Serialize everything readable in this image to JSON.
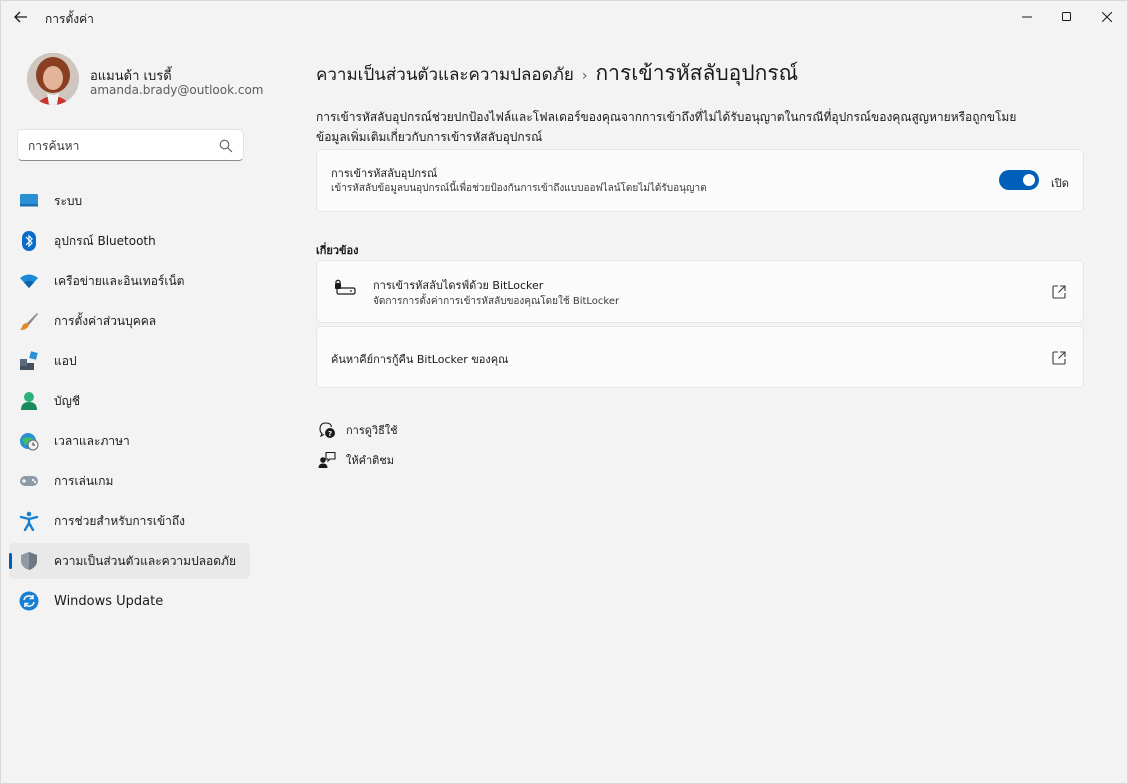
{
  "window": {
    "title": "การตั้งค่า"
  },
  "profile": {
    "name": "อแมนด้า เบรดี้",
    "email": "amanda.brady@outlook.com"
  },
  "search": {
    "placeholder": "การค้นหา"
  },
  "sidebar": {
    "items": [
      {
        "label": "ระบบ",
        "icon": "monitor-icon"
      },
      {
        "label": "อุปกรณ์ Bluetooth",
        "icon": "bluetooth-icon"
      },
      {
        "label": "เครือข่ายและอินเทอร์เน็ต",
        "icon": "wifi-icon"
      },
      {
        "label": "การตั้งค่าส่วนบุคคล",
        "icon": "brush-icon"
      },
      {
        "label": "แอป",
        "icon": "apps-icon"
      },
      {
        "label": "บัญชี",
        "icon": "account-icon"
      },
      {
        "label": "เวลาและภาษา",
        "icon": "globe-clock-icon"
      },
      {
        "label": "การเล่นเกม",
        "icon": "gamepad-icon"
      },
      {
        "label": "การช่วยสำหรับการเข้าถึง",
        "icon": "accessibility-icon"
      },
      {
        "label": "ความเป็นส่วนตัวและความปลอดภัย",
        "icon": "shield-icon",
        "active": true
      },
      {
        "label": "Windows Update",
        "icon": "update-icon"
      }
    ]
  },
  "header": {
    "parent": "ความเป็นส่วนตัวและความปลอดภัย",
    "separator": "›",
    "current": "การเข้ารหัสลับอุปกรณ์"
  },
  "main": {
    "description": "การเข้ารหัสลับอุปกรณ์ช่วยปกป้องไฟล์และโฟลเดอร์ของคุณจากการเข้าถึงที่ไม่ได้รับอนุญาตในกรณีที่อุปกรณ์ของคุณสูญหายหรือถูกขโมย",
    "learn_more": "ข้อมูลเพิ่มเติมเกี่ยวกับการเข้ารหัสลับอุปกรณ์",
    "encryption_card": {
      "title": "การเข้ารหัสลับอุปกรณ์",
      "subtitle": "เข้ารหัสลับข้อมูลบนอุปกรณ์นี้เพื่อช่วยป้องกันการเข้าถึงแบบออฟไลน์โดยไม่ได้รับอนุญาต",
      "toggle_state": "เปิด"
    },
    "related_title": "เกี่ยวข้อง",
    "bitlocker_card": {
      "title": "การเข้ารหัสลับไดรฟ์ด้วย BitLocker",
      "subtitle": "จัดการการตั้งค่าการเข้ารหัสลับของคุณโดยใช้ BitLocker"
    },
    "recovery_card": {
      "title": "ค้นหาคีย์การกู้คืน BitLocker ของคุณ"
    },
    "help": {
      "get_help": "การดูวิธีใช้",
      "feedback": "ให้คำติชม"
    }
  },
  "colors": {
    "accent": "#005fb8",
    "background": "#f3f3f3",
    "card": "#fbfbfb"
  }
}
